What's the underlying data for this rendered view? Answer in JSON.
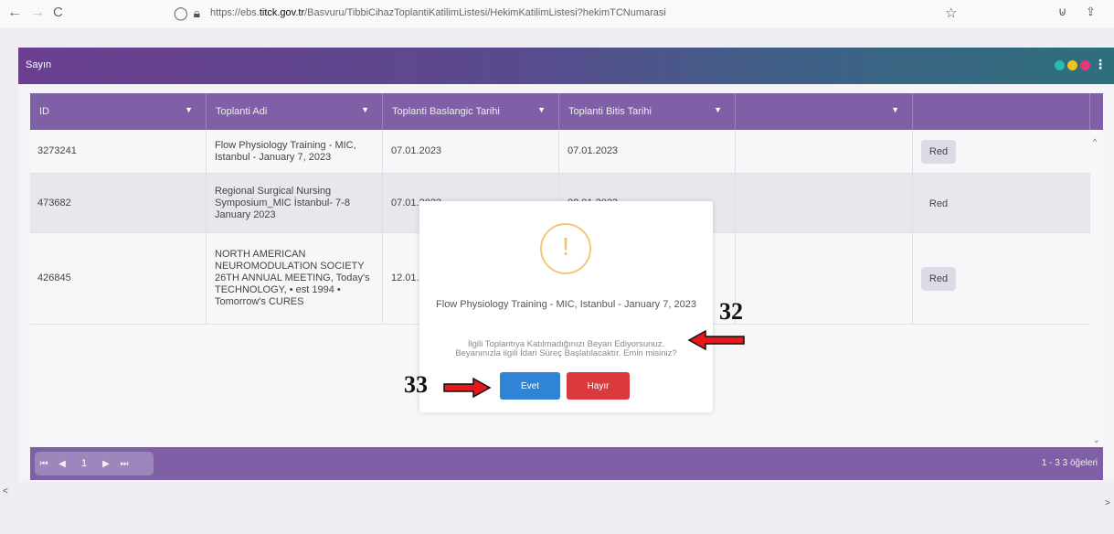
{
  "browser": {
    "back_icon": "←",
    "forward_icon": "→",
    "reload_icon": "C",
    "url_prefix": "https://ebs.",
    "url_domain": "titck.gov.tr",
    "url_path": "/Basvuru/TibbiCihazToplantiKatilimListesi/HekimKatilimListesi?hekimTCNumarasi"
  },
  "card": {
    "title": "Sayın",
    "dot_colors": [
      "#2bbbad",
      "#f0c419",
      "#e8357a"
    ]
  },
  "table": {
    "columns": [
      {
        "label": "ID"
      },
      {
        "label": "Toplanti Adi"
      },
      {
        "label": "Toplanti Baslangic Tarihi"
      },
      {
        "label": "Toplanti Bitis Tarihi"
      },
      {
        "label": ""
      },
      {
        "label": ""
      }
    ],
    "rows": [
      {
        "id": "3273241",
        "name": "Flow Physiology Training - MIC, Istanbul - January 7, 2023",
        "start": "07.01.2023",
        "end": "07.01.2023",
        "action": "Red"
      },
      {
        "id": "473682",
        "name": "Regional Surgical Nursing Symposium_MIC İstanbul- 7-8 January 2023",
        "start": "07.01.2023",
        "end": "08.01.2023",
        "action": "Red"
      },
      {
        "id": "426845",
        "name": "NORTH AMERICAN NEUROMODULATION SOCIETY 26TH ANNUAL MEETING, Today's TECHNOLOGY, • est 1994 • Tomorrow's CURES",
        "start": "12.01.2023",
        "end": "",
        "action": "Red"
      }
    ]
  },
  "pager": {
    "first": "⏮",
    "prev": "◀",
    "page": "1",
    "next": "▶",
    "last": "⏭",
    "info": "1 - 3 3 öğeleri"
  },
  "modal": {
    "icon": "!",
    "title": "Flow Physiology Training - MIC, Istanbul - January 7, 2023",
    "text_line1": "İlgili Toplantıya Katılmadığınızı Beyan Ediyorsunuz.",
    "text_line2": "Beyanınızla ilgili İdari Süreç Başlatılacaktır. Emin misiniz?",
    "confirm_label": "Evet",
    "cancel_label": "Hayır"
  },
  "annotations": {
    "label_32": "32",
    "label_33": "33"
  }
}
